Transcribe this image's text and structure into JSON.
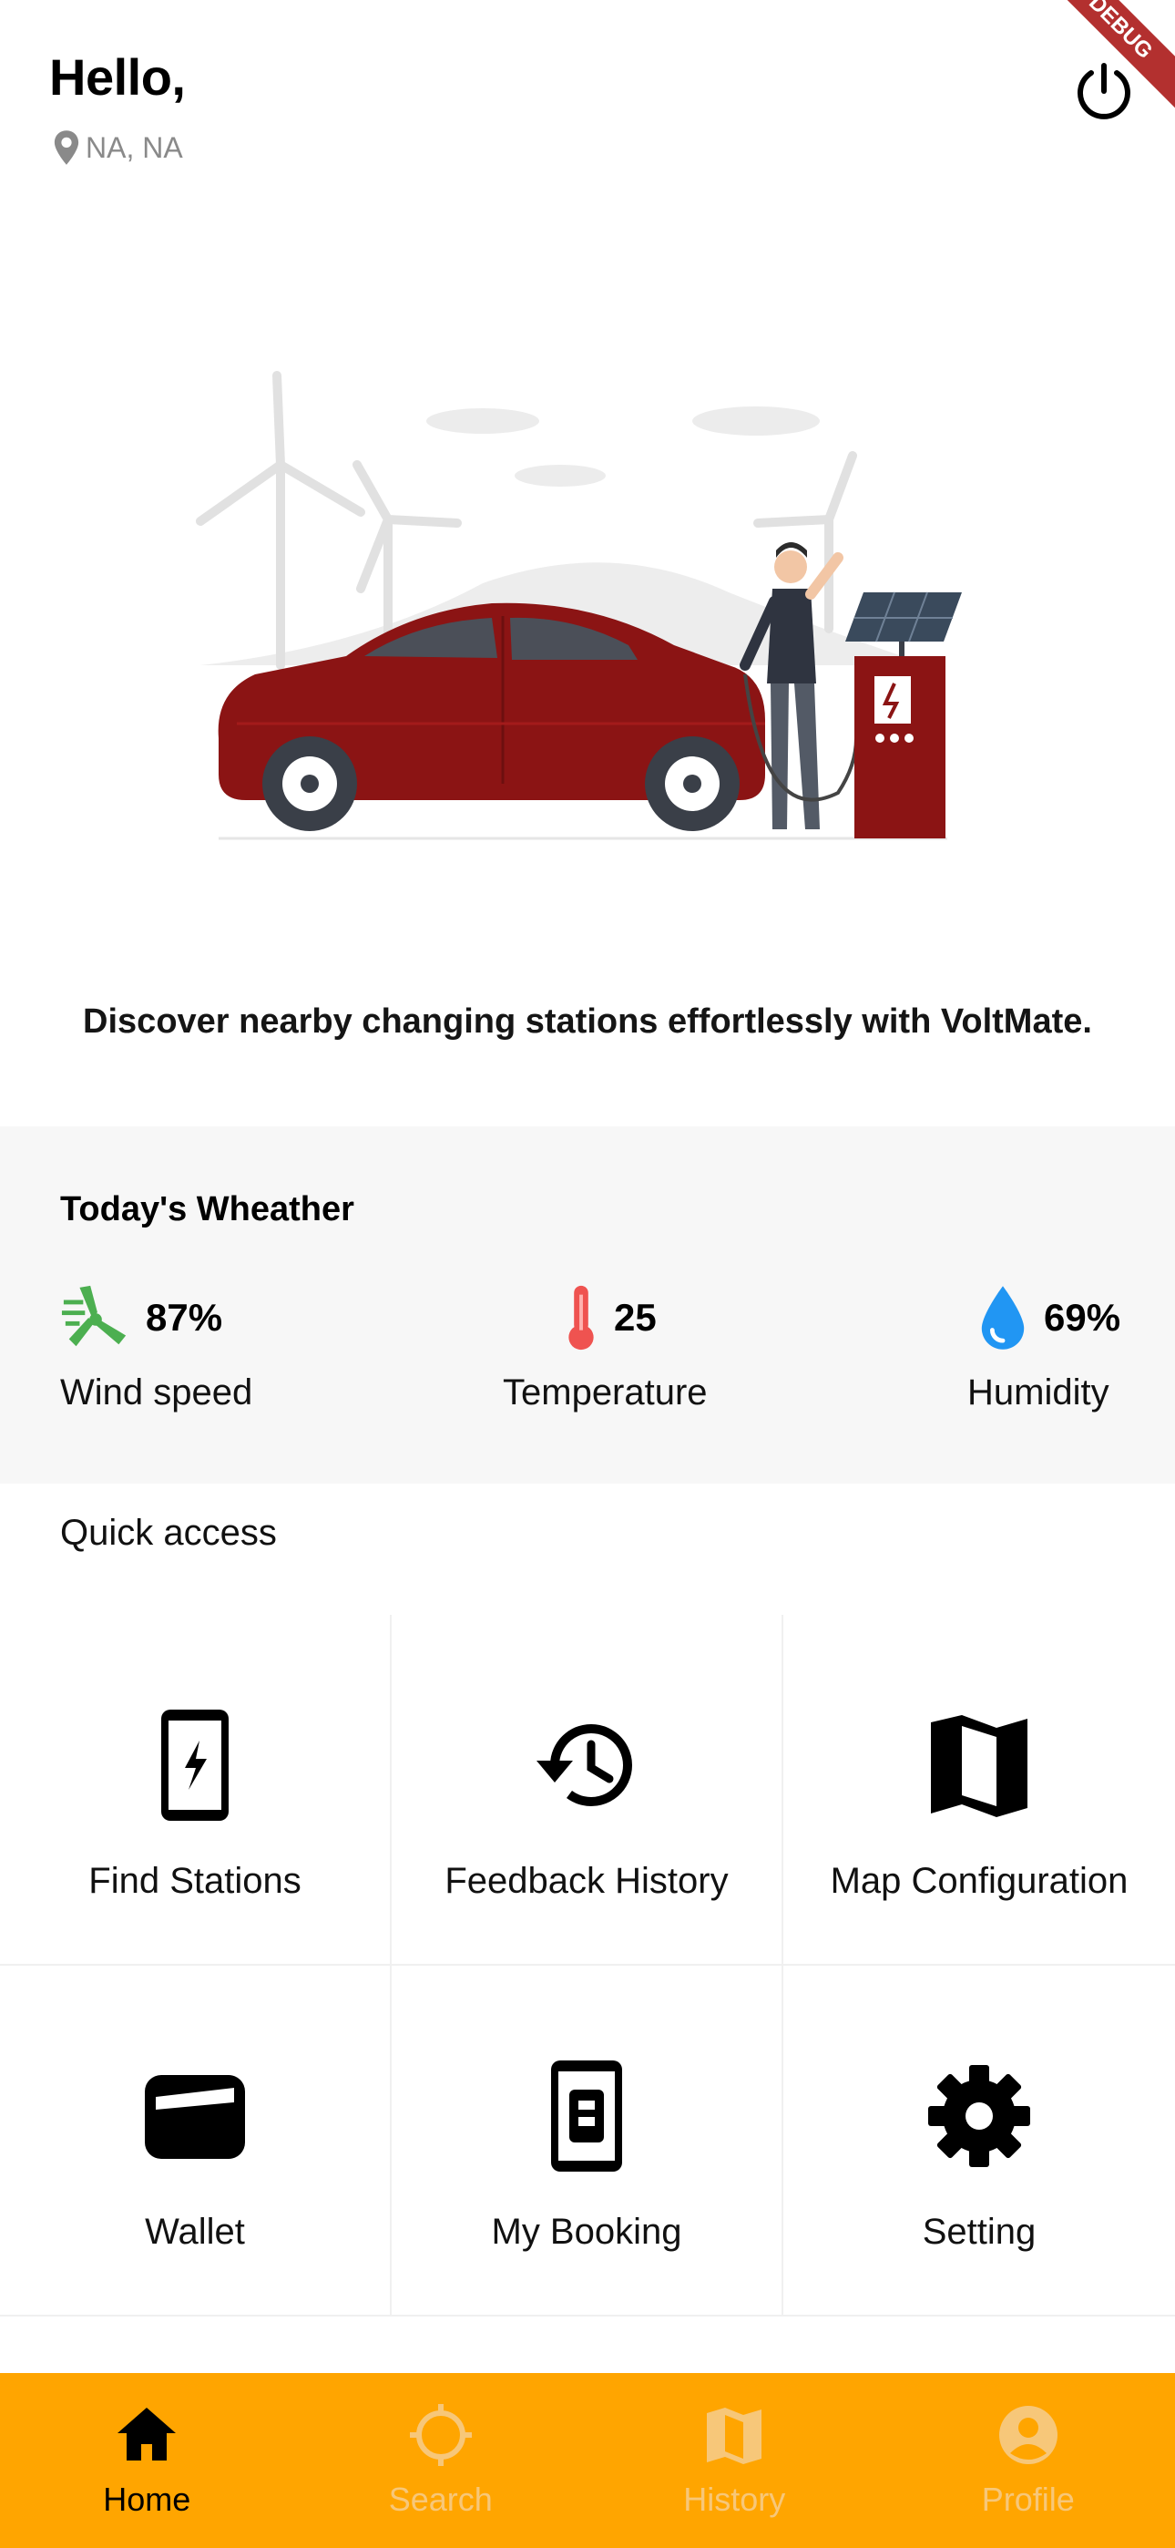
{
  "header": {
    "greeting": "Hello,",
    "location": "NA, NA",
    "debug_banner": "DEBUG"
  },
  "hero": {
    "tagline": "Discover nearby changing stations effortlessly with VoltMate."
  },
  "weather": {
    "title": "Today's Wheather",
    "items": [
      {
        "value": "87%",
        "label": "Wind speed",
        "icon": "wind-turbine-icon"
      },
      {
        "value": "25",
        "label": "Temperature",
        "icon": "thermometer-icon"
      },
      {
        "value": "69%",
        "label": "Humidity",
        "icon": "water-drop-icon"
      }
    ]
  },
  "quick_access": {
    "title": "Quick access",
    "tiles": [
      {
        "label": "Find Stations",
        "icon": "charging-phone-icon"
      },
      {
        "label": "Feedback History",
        "icon": "history-icon"
      },
      {
        "label": "Map Configuration",
        "icon": "map-icon"
      },
      {
        "label": "Wallet",
        "icon": "wallet-icon"
      },
      {
        "label": "My Booking",
        "icon": "booking-phone-icon"
      },
      {
        "label": "Setting",
        "icon": "gear-icon"
      }
    ]
  },
  "bottom_nav": {
    "items": [
      {
        "label": "Home",
        "icon": "home-icon",
        "active": true
      },
      {
        "label": "Search",
        "icon": "crosshair-icon",
        "active": false
      },
      {
        "label": "History",
        "icon": "map-icon",
        "active": false
      },
      {
        "label": "Profile",
        "icon": "account-circle-icon",
        "active": false
      }
    ]
  },
  "colors": {
    "accent": "#FFA500",
    "car": "#8B1414",
    "wind_icon": "#4CAF50",
    "thermometer_icon": "#EF5350",
    "humidity_icon": "#2196F3",
    "weather_bg": "#F7F7F7"
  }
}
